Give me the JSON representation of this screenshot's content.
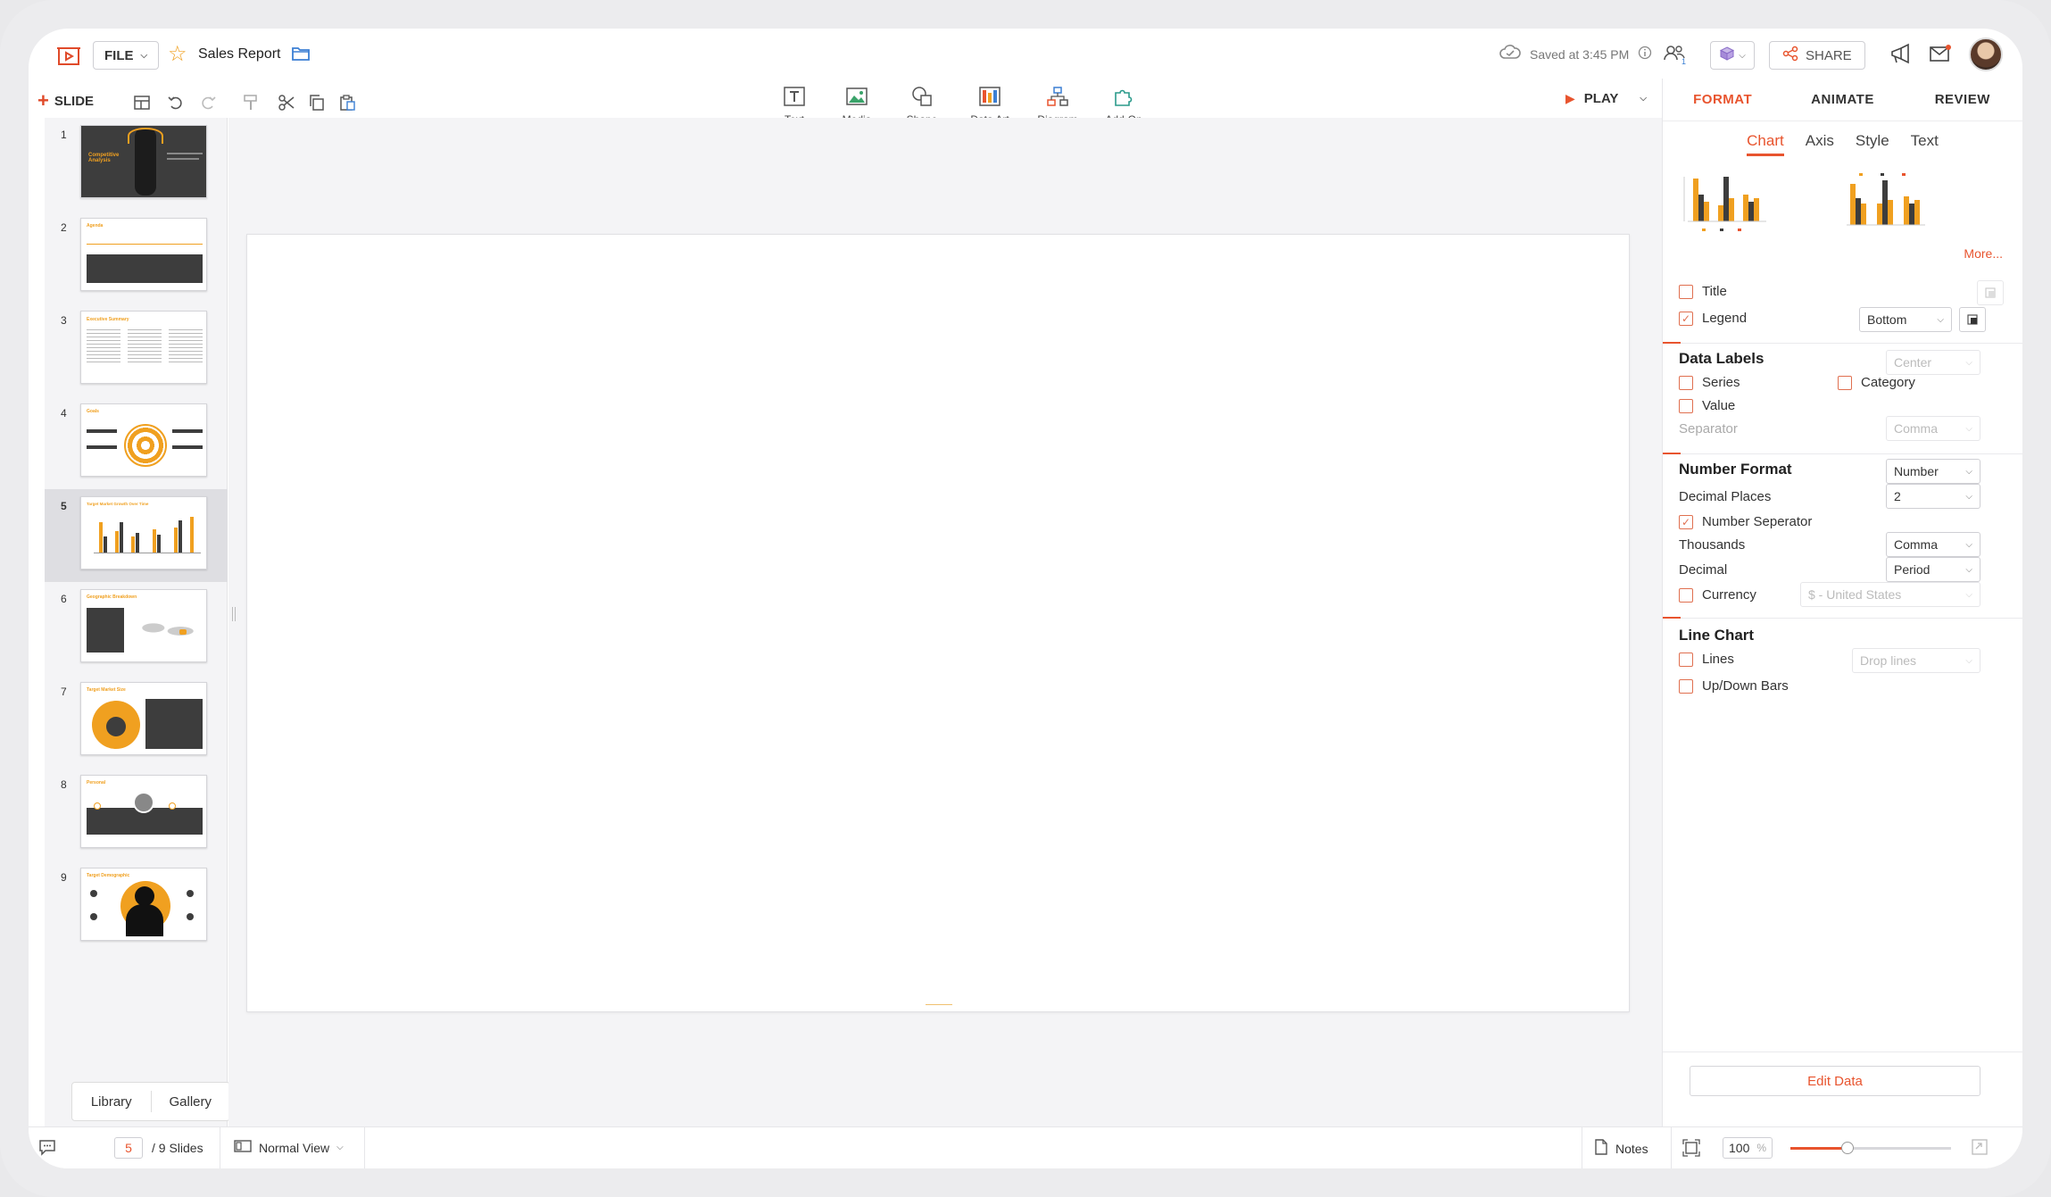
{
  "header": {
    "file_label": "FILE",
    "doc_title": "Sales Report",
    "saved_text": "Saved at 3:45 PM",
    "collab_count": "1",
    "share_label": "SHARE"
  },
  "toolbar": {
    "slide_label": "SLIDE",
    "insert": [
      {
        "label": "Text"
      },
      {
        "label": "Media"
      },
      {
        "label": "Shape"
      },
      {
        "label": "Data Art"
      },
      {
        "label": "Diagram"
      },
      {
        "label": "Add-On"
      }
    ],
    "play_label": "PLAY"
  },
  "thumbnails": {
    "items": [
      {
        "num": "1",
        "title": "Competitive Analysis"
      },
      {
        "num": "2",
        "title": "Agenda"
      },
      {
        "num": "3",
        "title": "Executive Summary"
      },
      {
        "num": "4",
        "title": "Goals"
      },
      {
        "num": "5",
        "title": "Target Market Growth Over Time"
      },
      {
        "num": "6",
        "title": "Geographic Breakdown"
      },
      {
        "num": "7",
        "title": "Target Market Size"
      },
      {
        "num": "8",
        "title": "Personal"
      },
      {
        "num": "9",
        "title": "Target Demographic"
      }
    ],
    "selected_index": 4,
    "library_label": "Library",
    "gallery_label": "Gallery"
  },
  "right_panel": {
    "tabs": [
      "FORMAT",
      "ANIMATE",
      "REVIEW"
    ],
    "active_tab": "FORMAT",
    "subtabs": [
      "Chart",
      "Axis",
      "Style",
      "Text"
    ],
    "active_subtab": "Chart",
    "more_label": "More...",
    "title_label": "Title",
    "legend_label": "Legend",
    "legend_position": "Bottom",
    "data_labels": {
      "heading": "Data Labels",
      "position": "Center",
      "series_label": "Series",
      "category_label": "Category",
      "value_label": "Value",
      "separator_label": "Separator",
      "separator_value": "Comma"
    },
    "number_format": {
      "heading": "Number Format",
      "format_value": "Number",
      "decimal_places_label": "Decimal Places",
      "decimal_places_value": "2",
      "number_separator_label": "Number Seperator",
      "thousands_label": "Thousands",
      "thousands_value": "Comma",
      "decimal_label": "Decimal",
      "decimal_value": "Period",
      "currency_label": "Currency",
      "currency_value": "$ - United States"
    },
    "line_chart": {
      "heading": "Line Chart",
      "lines_label": "Lines",
      "lines_value": "Drop lines",
      "updown_label": "Up/Down Bars"
    },
    "edit_data_label": "Edit Data"
  },
  "statusbar": {
    "current_slide": "5",
    "total_slides": "/ 9 Slides",
    "view_label": "Normal View",
    "notes_label": "Notes",
    "zoom_value": "100",
    "zoom_unit": "%"
  },
  "colors": {
    "accent": "#e8542e",
    "brand_orange": "#f0a020",
    "dark": "#3a3a3a"
  }
}
